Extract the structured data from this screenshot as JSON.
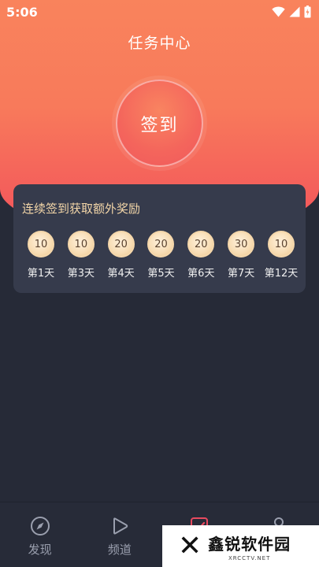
{
  "status_bar": {
    "time": "5:06"
  },
  "header": {
    "title": "任务中心"
  },
  "signin": {
    "label": "签到"
  },
  "reward_card": {
    "title": "连续签到获取额外奖励",
    "days": [
      {
        "value": "10",
        "label": "第1天"
      },
      {
        "value": "10",
        "label": "第3天"
      },
      {
        "value": "20",
        "label": "第4天"
      },
      {
        "value": "20",
        "label": "第5天"
      },
      {
        "value": "20",
        "label": "第6天"
      },
      {
        "value": "30",
        "label": "第7天"
      },
      {
        "value": "10",
        "label": "第12天"
      }
    ]
  },
  "tab_bar": {
    "tabs": [
      {
        "label": "发现",
        "icon": "compass-icon"
      },
      {
        "label": "频道",
        "icon": "play-icon"
      },
      {
        "label": "",
        "icon": "checkbox-icon"
      },
      {
        "label": "",
        "icon": "person-icon"
      }
    ]
  },
  "watermark": {
    "name": "鑫锐软件园",
    "url": "XRCCTV.NET"
  },
  "colors": {
    "hero_top": "#f9835c",
    "hero_bottom": "#f2515b",
    "background": "#262a37",
    "card": "#363b4c",
    "card_title": "#f3d6a8",
    "tab_active": "#e84a5f"
  }
}
